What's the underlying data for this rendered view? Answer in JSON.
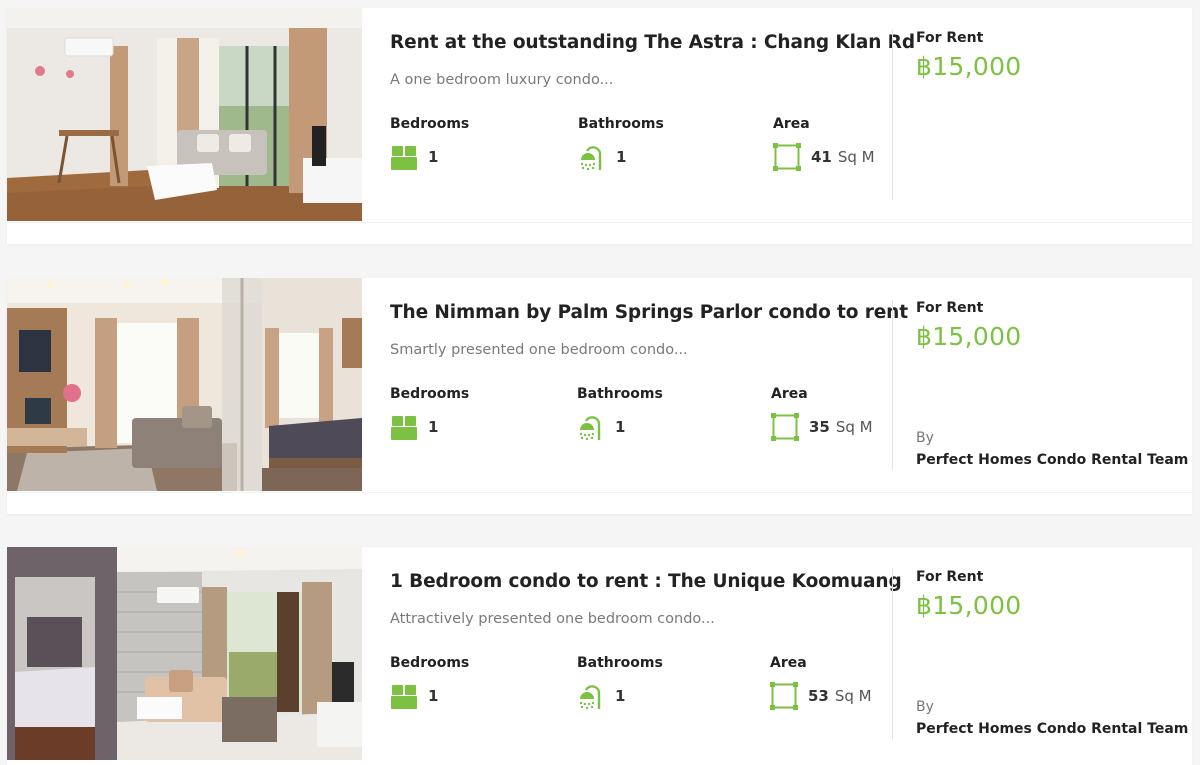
{
  "theme": {
    "accent": "#7cc142",
    "text": "#222222",
    "muted": "#7a7a7a"
  },
  "labels": {
    "bedrooms": "Bedrooms",
    "bathrooms": "Bathrooms",
    "area": "Area",
    "area_unit": "Sq M",
    "status": "For Rent",
    "by": "By"
  },
  "listings": [
    {
      "title": "Rent at the outstanding The Astra : Chang Klan Rd",
      "description": "A one bedroom luxury condo...",
      "bedrooms": "1",
      "bathrooms": "1",
      "area": "41",
      "price": "฿15,000",
      "agent": ""
    },
    {
      "title": "The Nimman by Palm Springs Parlor condo to rent",
      "description": "Smartly presented one bedroom condo...",
      "bedrooms": "1",
      "bathrooms": "1",
      "area": "35",
      "price": "฿15,000",
      "agent": "Perfect Homes Condo Rental Team"
    },
    {
      "title": "1 Bedroom condo to rent : The Unique Koomuang",
      "description": "Attractively presented one bedroom condo...",
      "bedrooms": "1",
      "bathrooms": "1",
      "area": "53",
      "price": "฿15,000",
      "agent": "Perfect Homes Condo Rental Team"
    }
  ]
}
